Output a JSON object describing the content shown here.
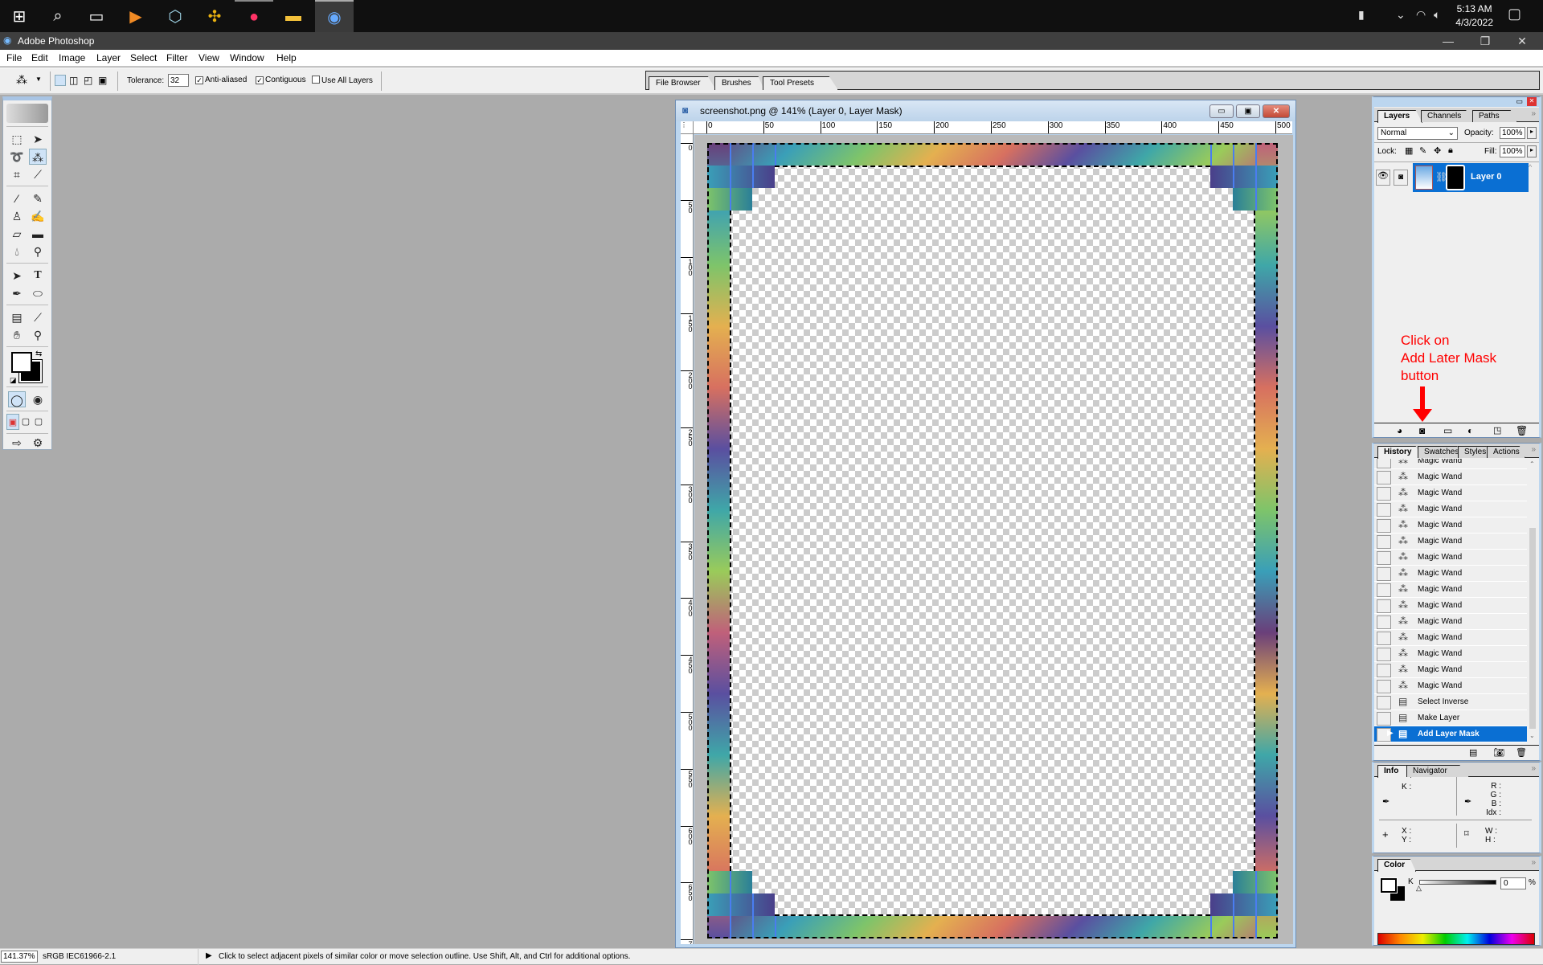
{
  "taskbar": {
    "icons": [
      "windows-start",
      "search",
      "task-view",
      "media-player",
      "virtualbox",
      "app-yellow",
      "firefox",
      "file-explorer",
      "photoshop"
    ],
    "time": "5:13 AM",
    "date": "4/3/2022"
  },
  "app": {
    "title": "Adobe Photoshop"
  },
  "menu": [
    "File",
    "Edit",
    "Image",
    "Layer",
    "Select",
    "Filter",
    "View",
    "Window",
    "Help"
  ],
  "options": {
    "tolerance_label": "Tolerance:",
    "tolerance_value": "32",
    "anti_aliased": "Anti-aliased",
    "anti_aliased_checked": true,
    "contiguous": "Contiguous",
    "contiguous_checked": true,
    "use_all_layers": "Use All Layers",
    "use_all_layers_checked": false,
    "palette_well_tabs": [
      "File Browser",
      "Brushes",
      "Tool Presets"
    ]
  },
  "document": {
    "title": "screenshot.png @ 141% (Layer 0, Layer Mask)",
    "hruler": [
      "0",
      "50",
      "100",
      "150",
      "200",
      "250",
      "300",
      "350",
      "400",
      "450",
      "500"
    ],
    "vruler": [
      "0",
      "50",
      "100",
      "150",
      "200",
      "250",
      "300",
      "350",
      "400",
      "450",
      "500",
      "550",
      "600",
      "650",
      "7"
    ]
  },
  "layers": {
    "tabs": [
      "Layers",
      "Channels",
      "Paths"
    ],
    "blend_mode": "Normal",
    "opacity_label": "Opacity:",
    "opacity": "100%",
    "lock_label": "Lock:",
    "fill_label": "Fill:",
    "fill": "100%",
    "layer_name": "Layer 0",
    "annotation": [
      "Click on",
      "Add Later Mask",
      "button"
    ],
    "annotation_color": "#ff0000"
  },
  "history": {
    "tabs": [
      "History",
      "Swatches",
      "Styles",
      "Actions"
    ],
    "items": [
      {
        "label": "Magic Wand",
        "icon": "magic-wand"
      },
      {
        "label": "Magic Wand",
        "icon": "magic-wand"
      },
      {
        "label": "Magic Wand",
        "icon": "magic-wand"
      },
      {
        "label": "Magic Wand",
        "icon": "magic-wand"
      },
      {
        "label": "Magic Wand",
        "icon": "magic-wand"
      },
      {
        "label": "Magic Wand",
        "icon": "magic-wand"
      },
      {
        "label": "Magic Wand",
        "icon": "magic-wand"
      },
      {
        "label": "Magic Wand",
        "icon": "magic-wand"
      },
      {
        "label": "Magic Wand",
        "icon": "magic-wand"
      },
      {
        "label": "Magic Wand",
        "icon": "magic-wand"
      },
      {
        "label": "Magic Wand",
        "icon": "magic-wand"
      },
      {
        "label": "Magic Wand",
        "icon": "magic-wand"
      },
      {
        "label": "Magic Wand",
        "icon": "magic-wand"
      },
      {
        "label": "Magic Wand",
        "icon": "magic-wand"
      },
      {
        "label": "Magic Wand",
        "icon": "magic-wand"
      },
      {
        "label": "Select Inverse",
        "icon": "history-state"
      },
      {
        "label": "Make Layer",
        "icon": "history-state"
      },
      {
        "label": "Add Layer Mask",
        "icon": "history-state",
        "selected": true
      }
    ]
  },
  "info": {
    "tabs": [
      "Info",
      "Navigator"
    ],
    "k_label": "K :",
    "rgb_labels": [
      "R :",
      "G :",
      "B :",
      "Idx :"
    ],
    "xy_labels": [
      "X :",
      "Y :"
    ],
    "wh_labels": [
      "W :",
      "H :"
    ]
  },
  "color": {
    "tab": "Color",
    "k_label": "K",
    "k_value": "0",
    "percent": "%"
  },
  "status": {
    "zoom": "141.37%",
    "profile": "sRGB IEC61966-2.1",
    "hint": "Click to select adjacent pixels of similar color or move selection outline.  Use Shift, Alt, and Ctrl for additional options."
  }
}
